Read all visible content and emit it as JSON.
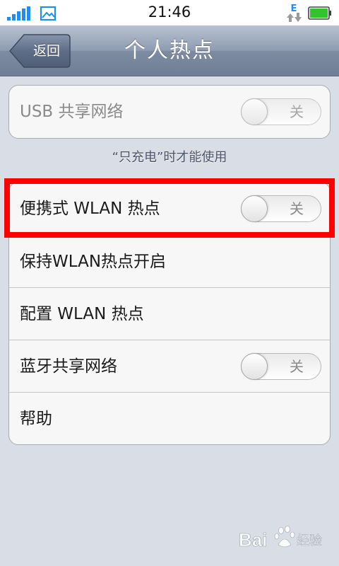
{
  "status_bar": {
    "time": "21:46",
    "network_letter": "E",
    "icons": [
      "signal-icon",
      "gallery-icon",
      "network-e-icon",
      "battery-icon"
    ]
  },
  "nav": {
    "back_label": "返回",
    "title": "个人热点"
  },
  "usb": {
    "label": "USB 共享网络",
    "toggle_text": "关",
    "enabled": false
  },
  "hint": "“只充电”时才能使用",
  "items": [
    {
      "label": "便携式 WLAN 热点",
      "toggle_text": "关"
    },
    {
      "label": "保持WLAN热点开启"
    },
    {
      "label": "配置 WLAN 热点"
    },
    {
      "label": "蓝牙共享网络",
      "toggle_text": "关"
    },
    {
      "label": "帮助"
    }
  ],
  "watermark": {
    "brand": "Bai",
    "suffix": "经验",
    "icon": "baidu-paw-icon"
  },
  "colors": {
    "highlight": "#ff0000",
    "nav_bar": "#8e9bb0",
    "battery": "#2fc52b",
    "signal": "#1e8ff0",
    "network_letter": "#1e8ff0"
  }
}
